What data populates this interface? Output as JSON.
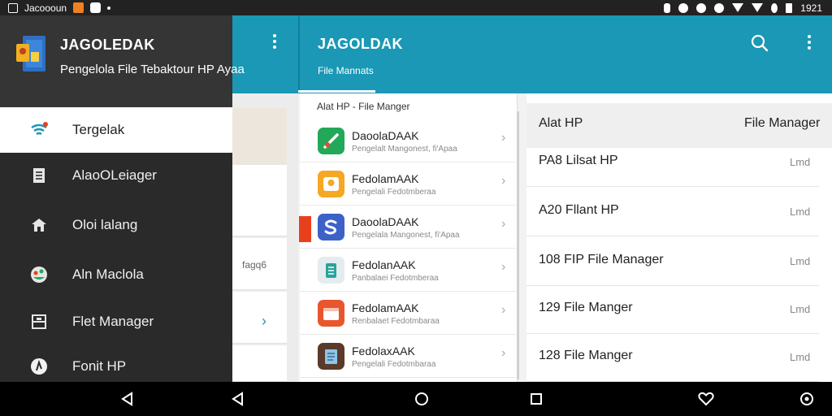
{
  "status_bar": {
    "left_text": "Jacoooun",
    "time": "1921"
  },
  "app": {
    "title": "JAGOLDAK",
    "tab": "File Mannats"
  },
  "drawer": {
    "title": "JAGOLEDAK",
    "subtitle": "Pengelola File Tebaktour HP Ayaa",
    "items": [
      {
        "label": "Tergelak",
        "icon": "wifi-signal-icon",
        "active": true
      },
      {
        "label": "AlaoOLeiager",
        "icon": "document-icon",
        "active": false
      },
      {
        "label": "Oloi lalang",
        "icon": "home-icon",
        "active": false
      },
      {
        "label": "Aln Maclola",
        "icon": "palette-icon",
        "active": false
      },
      {
        "label": "Flet Manager",
        "icon": "folder-icon",
        "active": false
      },
      {
        "label": "Fonit HP",
        "icon": "circle-arrow-icon",
        "active": false
      }
    ]
  },
  "left_pane": {
    "text": "fagq6"
  },
  "middle_list": {
    "header": "Alat HP - File Manger",
    "items": [
      {
        "title": "DaoolaDAAK",
        "subtitle": "Pengelalt Mangonest, fi'Apaa",
        "icon": "green-tool-icon",
        "color": "#23a85a"
      },
      {
        "title": "FedolamAAK",
        "subtitle": "Pengelali Fedotmberaa",
        "icon": "yellow-image-icon",
        "color": "#f6a723"
      },
      {
        "title": "DaoolaDAAK",
        "subtitle": "Pengelala Mangonest, fi'Apaa",
        "icon": "blue-s-icon",
        "color": "#3c62c8"
      },
      {
        "title": "FedolanAAK",
        "subtitle": "Panbalaei Fedotmberaa",
        "icon": "teal-chart-icon",
        "color": "#e4ecef"
      },
      {
        "title": "FedolamAAK",
        "subtitle": "Renbalaet Fedotmbaraa",
        "icon": "orange-card-icon",
        "color": "#e8562e"
      },
      {
        "title": "FedolaxAAK",
        "subtitle": "Pengelali Fedotmbaraa",
        "icon": "brown-file-icon",
        "color": "#5a3a2a"
      }
    ]
  },
  "details": {
    "header_left": "Alat HP",
    "header_right": "File Manager",
    "rows": [
      {
        "name": "PA8 Lilsat HP",
        "value": "Lmd"
      },
      {
        "name": "A20 Fllant HP",
        "value": "Lmd"
      },
      {
        "name": "108 FIP File Manager",
        "value": "Lmd"
      },
      {
        "name": "129 File Manger",
        "value": "Lmd"
      },
      {
        "name": "128 File Manger",
        "value": "Lmd"
      }
    ]
  },
  "colors": {
    "app_bar": "#1a98b5",
    "drawer": "#2a2a2a",
    "accent": "#2b8fb0"
  }
}
